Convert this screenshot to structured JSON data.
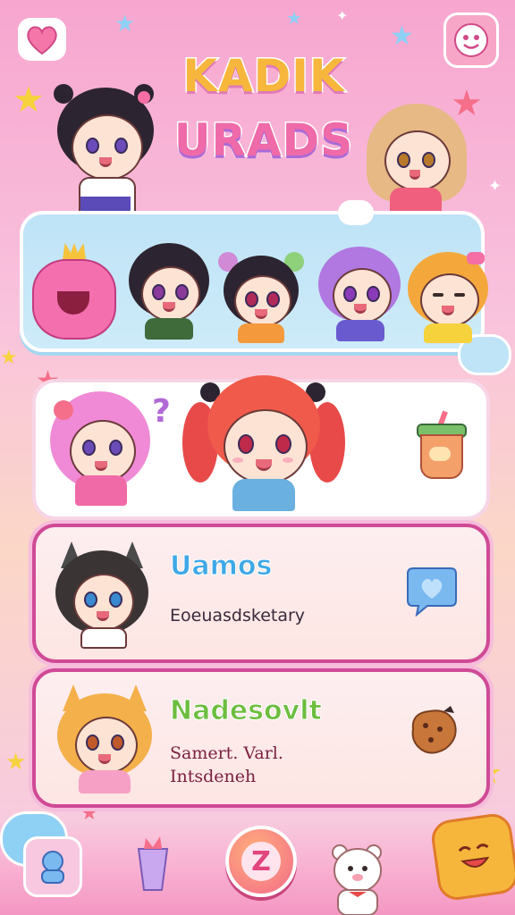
{
  "header": {
    "title_line1": "KADIK",
    "title_line2": "URADS"
  },
  "cards": [
    {
      "title": "Uamos",
      "subtitle": "Eoeuasdsketary"
    },
    {
      "title": "Nadesovlt",
      "subtitle_line1": "Samert. Varl.",
      "subtitle_line2": "Intsdeneh"
    }
  ],
  "bottom_nav": {
    "center_label": "Z"
  },
  "icons": {
    "top_left": "heart-icon",
    "top_right": "sticker-face-icon",
    "scene_question": "question-mark-icon",
    "scene_drink": "boba-drink-icon",
    "card1_action": "heart-bubble-icon",
    "card2_action": "cookie-icon"
  },
  "colors": {
    "accent_pink": "#d04a96",
    "title_yellow": "#f6b73c",
    "title_pink": "#ef6aa9",
    "card1_title": "#3fa8e6",
    "card2_title": "#6cbe3f"
  }
}
